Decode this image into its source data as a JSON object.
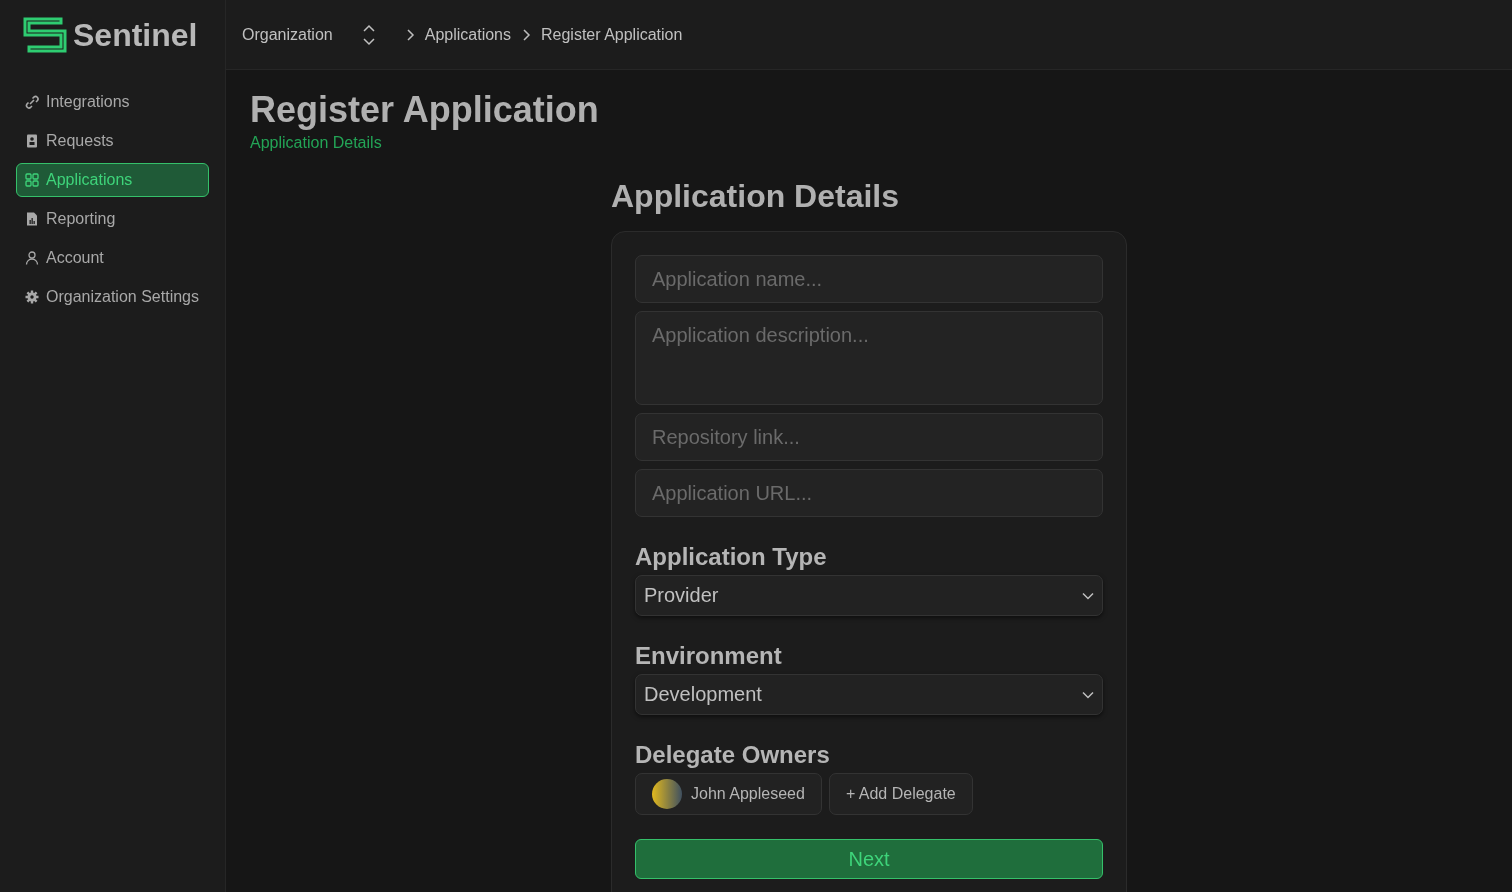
{
  "logo": {
    "text": "Sentinel"
  },
  "breadcrumb": {
    "organization": "Organization",
    "items": [
      "Applications",
      "Register Application"
    ]
  },
  "sidebar": {
    "items": [
      {
        "label": "Integrations",
        "selected": false
      },
      {
        "label": "Requests",
        "selected": false
      },
      {
        "label": "Applications",
        "selected": true
      },
      {
        "label": "Reporting",
        "selected": false
      },
      {
        "label": "Account",
        "selected": false
      },
      {
        "label": "Organization Settings",
        "selected": false
      }
    ]
  },
  "page": {
    "title": "Register Application",
    "subtitle": "Application Details"
  },
  "form": {
    "title": "Application Details",
    "fields": [
      {
        "kind": "input",
        "placeholder": "Application name..."
      },
      {
        "kind": "textarea",
        "placeholder": "Application description..."
      },
      {
        "kind": "input",
        "placeholder": "Repository link..."
      },
      {
        "kind": "input",
        "placeholder": "Application URL..."
      }
    ],
    "sections": [
      {
        "kind": "select",
        "label": "Application Type",
        "value": "Provider"
      },
      {
        "kind": "select",
        "label": "Environment",
        "value": "Development"
      },
      {
        "kind": "delegates",
        "label": "Delegate Owners",
        "delegates": [
          "John Appleseed"
        ],
        "add_button": "+ Add Delegate"
      }
    ],
    "submit": "Next"
  }
}
